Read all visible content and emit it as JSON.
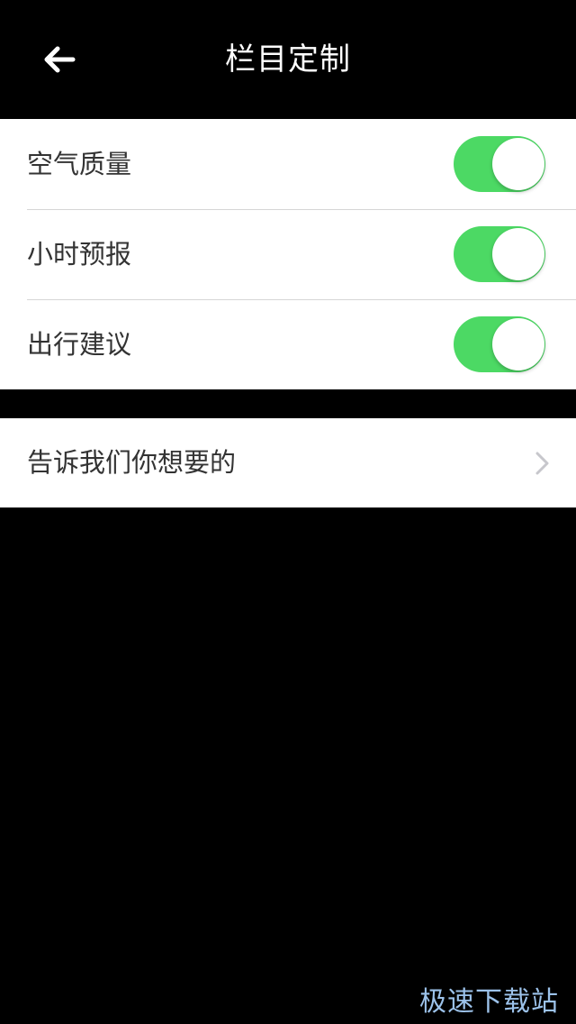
{
  "header": {
    "title": "栏目定制",
    "back_icon": "back-arrow-icon"
  },
  "settings": {
    "items": [
      {
        "label": "空气质量",
        "enabled": true
      },
      {
        "label": "小时预报",
        "enabled": true
      },
      {
        "label": "出行建议",
        "enabled": true
      }
    ]
  },
  "feedback": {
    "label": "告诉我们你想要的",
    "icon": "chevron-right-icon"
  },
  "watermark": {
    "text": "极速下载站"
  },
  "colors": {
    "toggle_on": "#4cd964",
    "background": "#000000",
    "card": "#ffffff",
    "label_text": "#333333"
  }
}
